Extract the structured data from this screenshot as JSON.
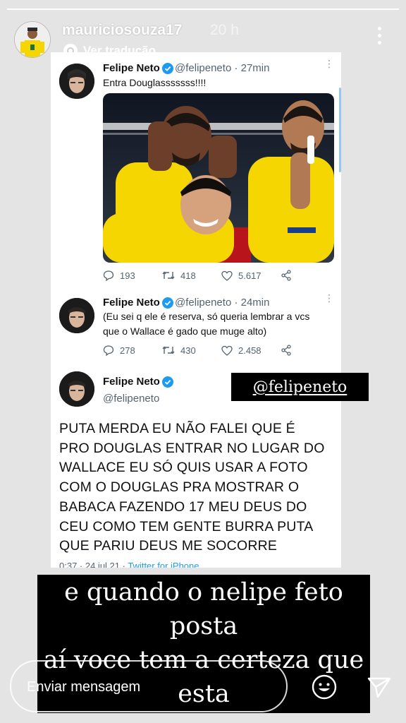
{
  "story": {
    "username": "mauriciosouza17",
    "time_ago": "20 h",
    "translate_label": "Ver tradução",
    "progress": 1.0
  },
  "tweets": [
    {
      "name": "Felipe Neto",
      "handle": "@felipeneto",
      "time": "· 27min",
      "text": "Entra Douglasssssss!!!!",
      "has_photo": true,
      "replies": "193",
      "retweets": "418",
      "likes": "5.617"
    },
    {
      "name": "Felipe Neto",
      "handle": "@felipeneto",
      "time": "· 24min",
      "text_lines": [
        "(Eu sei q ele é reserva, só queria lembrar a vcs",
        "que o Wallace é gado que muge alto)"
      ],
      "replies": "278",
      "retweets": "430",
      "likes": "2.458"
    },
    {
      "name": "Felipe Neto",
      "handle": "@felipeneto",
      "text_lines": [
        "PUTA MERDA EU NÃO FALEI QUE É",
        "PRO DOUGLAS ENTRAR NO LUGAR DO",
        "WALLACE EU SÓ QUIS USAR A FOTO",
        "COM O DOUGLAS PRA MOSTRAR O",
        "BABACA FAZENDO 17 MEU DEUS DO",
        "CEU COMO TEM GENTE BURRA PUTA",
        "QUE PARIU DEUS ME SOCORRE"
      ],
      "date": "0:37 · 24 jul 21 · ",
      "source": "Twitter for iPhone"
    }
  ],
  "sticker": {
    "text": "@felipeneto"
  },
  "caption": {
    "lines": [
      "e quando o nelipe feto",
      "posta",
      "aí voce tem a certeza que",
      "esta"
    ]
  },
  "reply": {
    "placeholder": "Enviar mensagem"
  },
  "colors": {
    "background": "#e4e4e4",
    "verified": "#1d9bf0",
    "jersey_yellow": "#f6d600"
  },
  "icons": [
    "more-vertical-icon",
    "translate-icon",
    "verified-icon",
    "reply-icon",
    "retweet-icon",
    "like-icon",
    "share-icon",
    "emoji-icon",
    "send-icon"
  ]
}
